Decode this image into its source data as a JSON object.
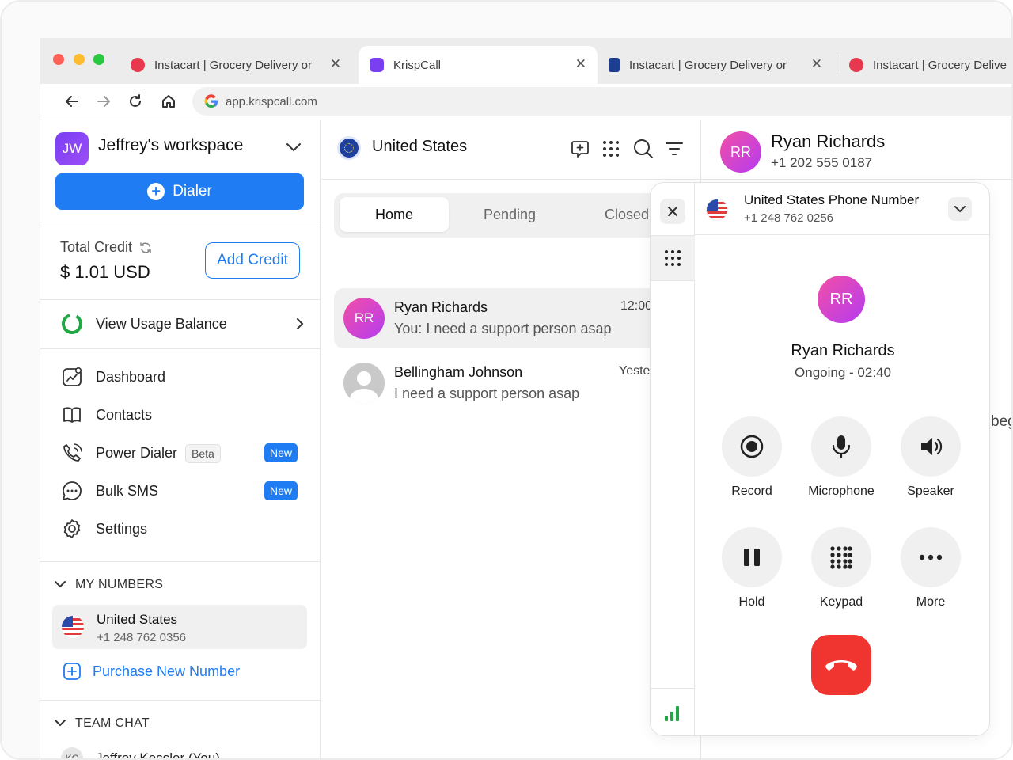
{
  "browser": {
    "tabs": [
      {
        "label": "Instacart | Grocery Delivery or",
        "favicon": "instacart-icon",
        "color": "#e8384f"
      },
      {
        "label": "KrispCall",
        "favicon": "krispcall-icon",
        "color": "#7b3ff2"
      },
      {
        "label": "Instacart | Grocery Delivery or",
        "favicon": "paypal-icon",
        "color": "#1d3f8f"
      },
      {
        "label": "Instacart | Grocery Delive",
        "favicon": "instacart-icon",
        "color": "#e8384f"
      }
    ],
    "url": "app.krispcall.com"
  },
  "sidebar": {
    "workspace": {
      "initials": "JW",
      "name": "Jeffrey's workspace"
    },
    "dialer_label": "Dialer",
    "credit": {
      "label": "Total Credit",
      "amount": "$ 1.01 USD",
      "add_label": "Add Credit"
    },
    "usage_label": "View Usage Balance",
    "menu": [
      {
        "label": "Dashboard",
        "icon": "dashboard-icon"
      },
      {
        "label": "Contacts",
        "icon": "book-icon"
      },
      {
        "label": "Power Dialer",
        "icon": "phone-icon",
        "beta": "Beta",
        "badge": "New"
      },
      {
        "label": "Bulk SMS",
        "icon": "chat-icon",
        "badge": "New"
      },
      {
        "label": "Settings",
        "icon": "gear-icon"
      }
    ],
    "my_numbers": {
      "title": "MY NUMBERS",
      "country": "United States",
      "number": "+1 248 762 0356",
      "purchase_label": "Purchase New Number"
    },
    "team_chat": {
      "title": "TEAM CHAT",
      "first_member_initials": "KC",
      "first_member": "Jeffrey Kessler (You)"
    }
  },
  "inbox": {
    "title": "United States",
    "tabs": [
      "Home",
      "Pending",
      "Closed"
    ],
    "conversations": [
      {
        "initials": "RR",
        "name": "Ryan Richards",
        "message": "You: I need a support person asap",
        "time": "12:00"
      },
      {
        "initials": "",
        "name": "Bellingham Johnson",
        "message": "I need a support person asap",
        "time": "Yeste"
      }
    ]
  },
  "contact": {
    "initials": "RR",
    "name": "Ryan Richards",
    "phone": "+1 202 555 0187",
    "side_text": "beg"
  },
  "call": {
    "line_title": "United States Phone Number",
    "line_number": "+1 248 762 0256",
    "initials": "RR",
    "name": "Ryan Richards",
    "status": "Ongoing - 02:40",
    "controls": [
      "Record",
      "Microphone",
      "Speaker",
      "Hold",
      "Keypad",
      "More"
    ],
    "colors": {
      "end": "#f0342f",
      "accent": "#1f7cf3",
      "signal": "#22a745"
    }
  }
}
